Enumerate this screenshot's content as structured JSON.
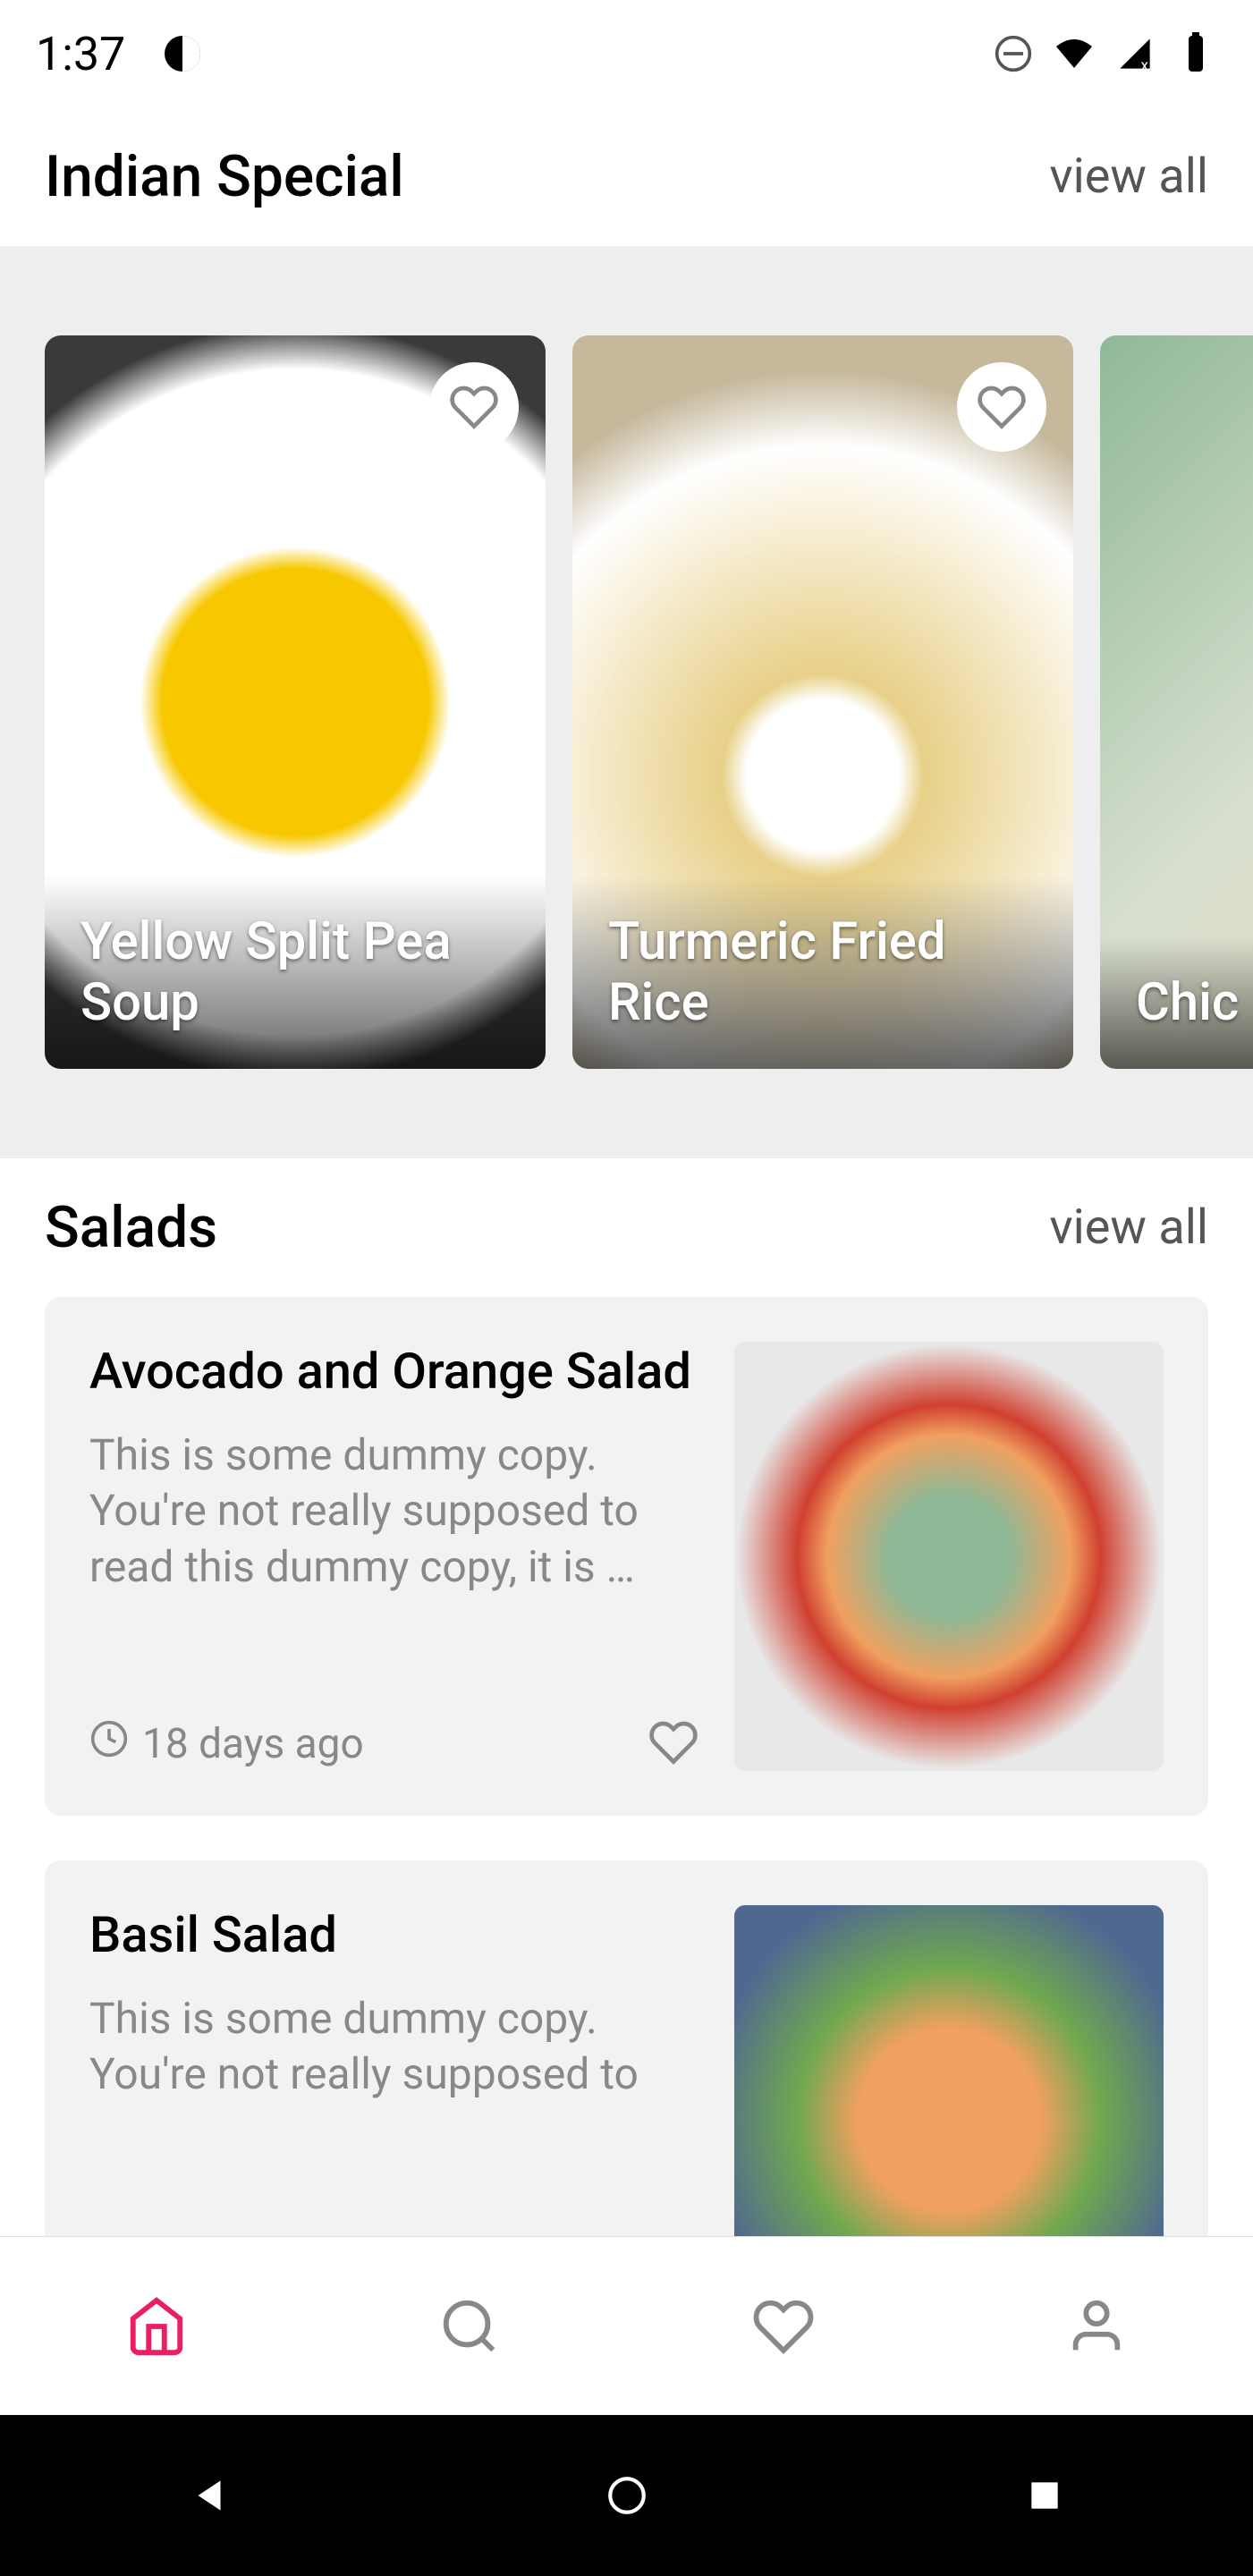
{
  "status_bar": {
    "time": "1:37"
  },
  "sections": {
    "indian_special": {
      "title": "Indian Special",
      "view_all": "view all",
      "recipes": [
        {
          "title": "Yellow Split Pea Soup"
        },
        {
          "title": "Turmeric Fried Rice"
        },
        {
          "title": "Chic"
        }
      ]
    },
    "salads": {
      "title": "Salads",
      "view_all": "view all",
      "items": [
        {
          "title": "Avocado and Orange Salad",
          "description": "This is some dummy copy. You're not really supposed to read this dummy copy, it is …",
          "time": "18 days ago"
        },
        {
          "title": "Basil Salad",
          "description": "This is some dummy copy. You're not really supposed to"
        }
      ]
    }
  },
  "colors": {
    "accent": "#e91e63",
    "icon_inactive": "#888888"
  }
}
